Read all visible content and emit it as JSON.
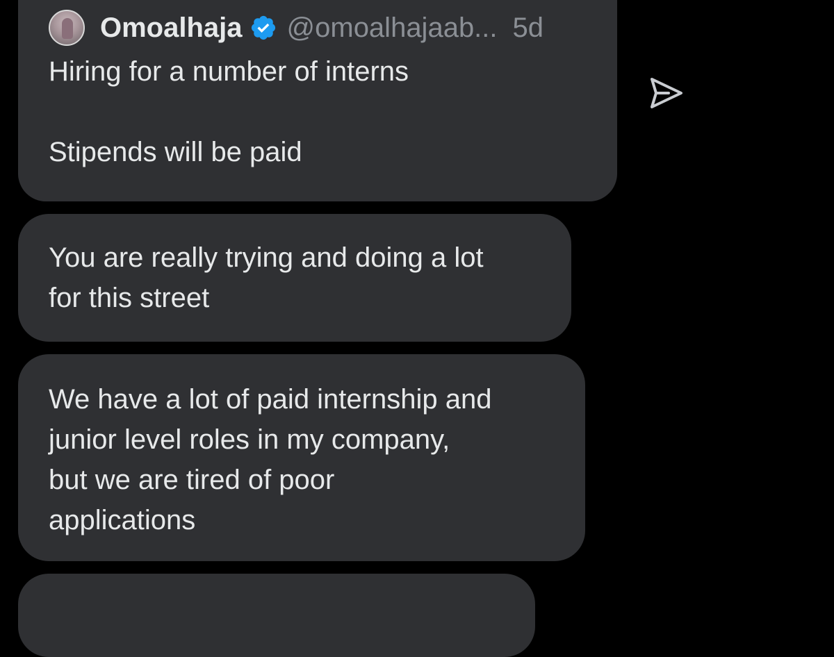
{
  "shared_tweet": {
    "author_name": "Omoalhaja",
    "handle": "@omoalhajaab...",
    "time": "5d",
    "text": "Hiring for a number of interns\n\nStipends will be paid"
  },
  "messages": [
    {
      "text": "You are really trying and doing a lot\nfor this street"
    },
    {
      "text": "We have a lot of paid internship and\njunior level roles in my company,\nbut we are tired of poor\napplications"
    }
  ],
  "icons": {
    "verified": "verified-badge-icon",
    "send": "send-icon",
    "avatar": "avatar"
  },
  "colors": {
    "background": "#000000",
    "bubble": "#2f3033",
    "text": "#e7e9ea",
    "muted": "#8b8f95",
    "verified_blue": "#1d9bf0"
  }
}
